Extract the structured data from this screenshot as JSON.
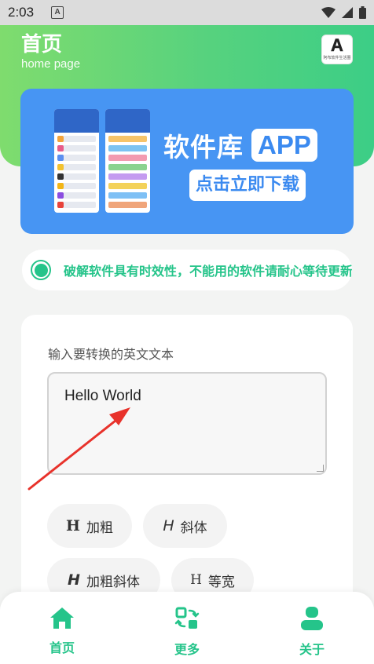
{
  "status_bar": {
    "time": "2:03",
    "notification_icon": "A"
  },
  "header": {
    "title": "首页",
    "subtitle": "home page",
    "logo_letter": "A",
    "logo_caption": "阿布软件生活圈"
  },
  "banner": {
    "name": "软件库",
    "app_badge": "APP",
    "cta": "点击立即下载"
  },
  "notice": {
    "text": "破解软件具有时效性，不能用的软件请耐心等待更新"
  },
  "converter": {
    "label": "输入要转换的英文文本",
    "input_value": "Hello World",
    "styles": [
      {
        "glyph": "H",
        "label": "加粗"
      },
      {
        "glyph": "H",
        "label": "斜体"
      },
      {
        "glyph": "H",
        "label": "加粗斜体"
      },
      {
        "glyph": "H",
        "label": "等宽"
      }
    ]
  },
  "nav": {
    "items": [
      {
        "label": "首页",
        "icon": "home-icon"
      },
      {
        "label": "更多",
        "icon": "exchange-icon"
      },
      {
        "label": "关于",
        "icon": "user-icon"
      }
    ],
    "active_color": "#25c48a"
  },
  "colors": {
    "accent": "#25c48a",
    "banner": "#4795f3",
    "arrow": "#e8322b"
  }
}
